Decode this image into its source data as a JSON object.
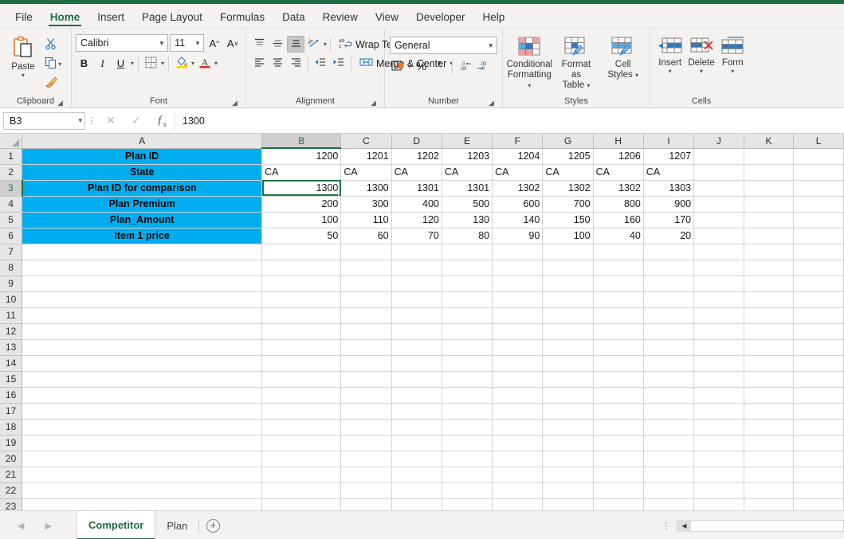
{
  "app": {
    "accent_green": "#1d6f42",
    "label_fill": "#00AEEF"
  },
  "ribbon_tabs": [
    {
      "label": "File",
      "active": false
    },
    {
      "label": "Home",
      "active": true
    },
    {
      "label": "Insert",
      "active": false
    },
    {
      "label": "Page Layout",
      "active": false
    },
    {
      "label": "Formulas",
      "active": false
    },
    {
      "label": "Data",
      "active": false
    },
    {
      "label": "Review",
      "active": false
    },
    {
      "label": "View",
      "active": false
    },
    {
      "label": "Developer",
      "active": false
    },
    {
      "label": "Help",
      "active": false
    }
  ],
  "clipboard": {
    "group_label": "Clipboard",
    "paste_label": "Paste",
    "cut_icon": "scissors-icon",
    "copy_icon": "copy-icon",
    "format_painter_icon": "format-painter-icon"
  },
  "font": {
    "group_label": "Font",
    "font_name": "Calibri",
    "font_size": "11",
    "grow_font": "A",
    "shrink_font": "A",
    "bold": "B",
    "italic": "I",
    "underline": "U",
    "borders_icon": "borders-icon",
    "fill_color_icon": "fill-color-icon",
    "font_color_icon": "font-color-icon"
  },
  "alignment": {
    "group_label": "Alignment",
    "top_align_icon": "align-top-icon",
    "middle_align_icon": "align-middle-icon",
    "bottom_align_icon": "align-bottom-icon",
    "orientation_icon": "orientation-icon",
    "wrap_text_label": "Wrap Text",
    "align_left_icon": "align-left-icon",
    "align_center_icon": "align-center-icon",
    "align_right_icon": "align-right-icon",
    "decrease_indent_icon": "decrease-indent-icon",
    "increase_indent_icon": "increase-indent-icon",
    "merge_center_label": "Merge & Center"
  },
  "number": {
    "group_label": "Number",
    "format": "General",
    "accounting_icon": "accounting-format-icon",
    "percent": "%",
    "comma": "'",
    "increase_decimal_icon": "increase-decimal-icon",
    "decrease_decimal_icon": "decrease-decimal-icon"
  },
  "styles": {
    "group_label": "Styles",
    "conditional_formatting": "Conditional\nFormatting",
    "conditional_formatting_l1": "Conditional",
    "conditional_formatting_l2": "Formatting",
    "format_as_table_l1": "Format as",
    "format_as_table_l2": "Table",
    "cell_styles_l1": "Cell",
    "cell_styles_l2": "Styles"
  },
  "cells": {
    "group_label": "Cells",
    "insert_label": "Insert",
    "delete_label": "Delete",
    "format_label": "Form"
  },
  "formula_bar": {
    "name_box": "B3",
    "cancel_icon": "cancel-icon",
    "enter_icon": "confirm-check-icon",
    "fx_icon": "fx-icon",
    "value": "1300"
  },
  "grid": {
    "columns": [
      "A",
      "B",
      "C",
      "D",
      "E",
      "F",
      "G",
      "H",
      "I",
      "J",
      "K",
      "L"
    ],
    "selected_column": "B",
    "selected_row": 3,
    "selected_cell": "B3",
    "rows": [
      {
        "n": 1,
        "cells": [
          "Plan ID",
          "1200",
          "1201",
          "1202",
          "1203",
          "1204",
          "1205",
          "1206",
          "1207",
          "",
          "",
          ""
        ]
      },
      {
        "n": 2,
        "cells": [
          "State",
          "CA",
          "CA",
          "CA",
          "CA",
          "CA",
          "CA",
          "CA",
          "CA",
          "",
          "",
          ""
        ]
      },
      {
        "n": 3,
        "cells": [
          "Plan ID for comparison",
          "1300",
          "1300",
          "1301",
          "1301",
          "1302",
          "1302",
          "1302",
          "1303",
          "",
          "",
          ""
        ]
      },
      {
        "n": 4,
        "cells": [
          "Plan Premium",
          "200",
          "300",
          "400",
          "500",
          "600",
          "700",
          "800",
          "900",
          "",
          "",
          ""
        ]
      },
      {
        "n": 5,
        "cells": [
          "Plan_Amount",
          "100",
          "110",
          "120",
          "130",
          "140",
          "150",
          "160",
          "170",
          "",
          "",
          ""
        ]
      },
      {
        "n": 6,
        "cells": [
          "Item 1 price",
          "50",
          "60",
          "70",
          "80",
          "90",
          "100",
          "40",
          "20",
          "",
          "",
          ""
        ]
      },
      {
        "n": 7,
        "cells": [
          "",
          "",
          "",
          "",
          "",
          "",
          "",
          "",
          "",
          "",
          "",
          ""
        ]
      },
      {
        "n": 8,
        "cells": [
          "",
          "",
          "",
          "",
          "",
          "",
          "",
          "",
          "",
          "",
          "",
          ""
        ]
      },
      {
        "n": 9,
        "cells": [
          "",
          "",
          "",
          "",
          "",
          "",
          "",
          "",
          "",
          "",
          "",
          ""
        ]
      },
      {
        "n": 10,
        "cells": [
          "",
          "",
          "",
          "",
          "",
          "",
          "",
          "",
          "",
          "",
          "",
          ""
        ]
      },
      {
        "n": 11,
        "cells": [
          "",
          "",
          "",
          "",
          "",
          "",
          "",
          "",
          "",
          "",
          "",
          ""
        ]
      },
      {
        "n": 12,
        "cells": [
          "",
          "",
          "",
          "",
          "",
          "",
          "",
          "",
          "",
          "",
          "",
          ""
        ]
      },
      {
        "n": 13,
        "cells": [
          "",
          "",
          "",
          "",
          "",
          "",
          "",
          "",
          "",
          "",
          "",
          ""
        ]
      },
      {
        "n": 14,
        "cells": [
          "",
          "",
          "",
          "",
          "",
          "",
          "",
          "",
          "",
          "",
          "",
          ""
        ]
      },
      {
        "n": 15,
        "cells": [
          "",
          "",
          "",
          "",
          "",
          "",
          "",
          "",
          "",
          "",
          "",
          ""
        ]
      },
      {
        "n": 16,
        "cells": [
          "",
          "",
          "",
          "",
          "",
          "",
          "",
          "",
          "",
          "",
          "",
          ""
        ]
      },
      {
        "n": 17,
        "cells": [
          "",
          "",
          "",
          "",
          "",
          "",
          "",
          "",
          "",
          "",
          "",
          ""
        ]
      },
      {
        "n": 18,
        "cells": [
          "",
          "",
          "",
          "",
          "",
          "",
          "",
          "",
          "",
          "",
          "",
          ""
        ]
      },
      {
        "n": 19,
        "cells": [
          "",
          "",
          "",
          "",
          "",
          "",
          "",
          "",
          "",
          "",
          "",
          ""
        ]
      },
      {
        "n": 20,
        "cells": [
          "",
          "",
          "",
          "",
          "",
          "",
          "",
          "",
          "",
          "",
          "",
          ""
        ]
      },
      {
        "n": 21,
        "cells": [
          "",
          "",
          "",
          "",
          "",
          "",
          "",
          "",
          "",
          "",
          "",
          ""
        ]
      },
      {
        "n": 22,
        "cells": [
          "",
          "",
          "",
          "",
          "",
          "",
          "",
          "",
          "",
          "",
          "",
          ""
        ]
      },
      {
        "n": 23,
        "cells": [
          "",
          "",
          "",
          "",
          "",
          "",
          "",
          "",
          "",
          "",
          "",
          ""
        ]
      }
    ]
  },
  "sheet_bar": {
    "prev_icon": "prev-sheet-icon",
    "next_icon": "next-sheet-icon",
    "tabs": [
      {
        "label": "Competitor",
        "active": true
      },
      {
        "label": "Plan",
        "active": false
      }
    ],
    "add_sheet": "+",
    "scroll_left_icon": "scroll-left-icon"
  }
}
